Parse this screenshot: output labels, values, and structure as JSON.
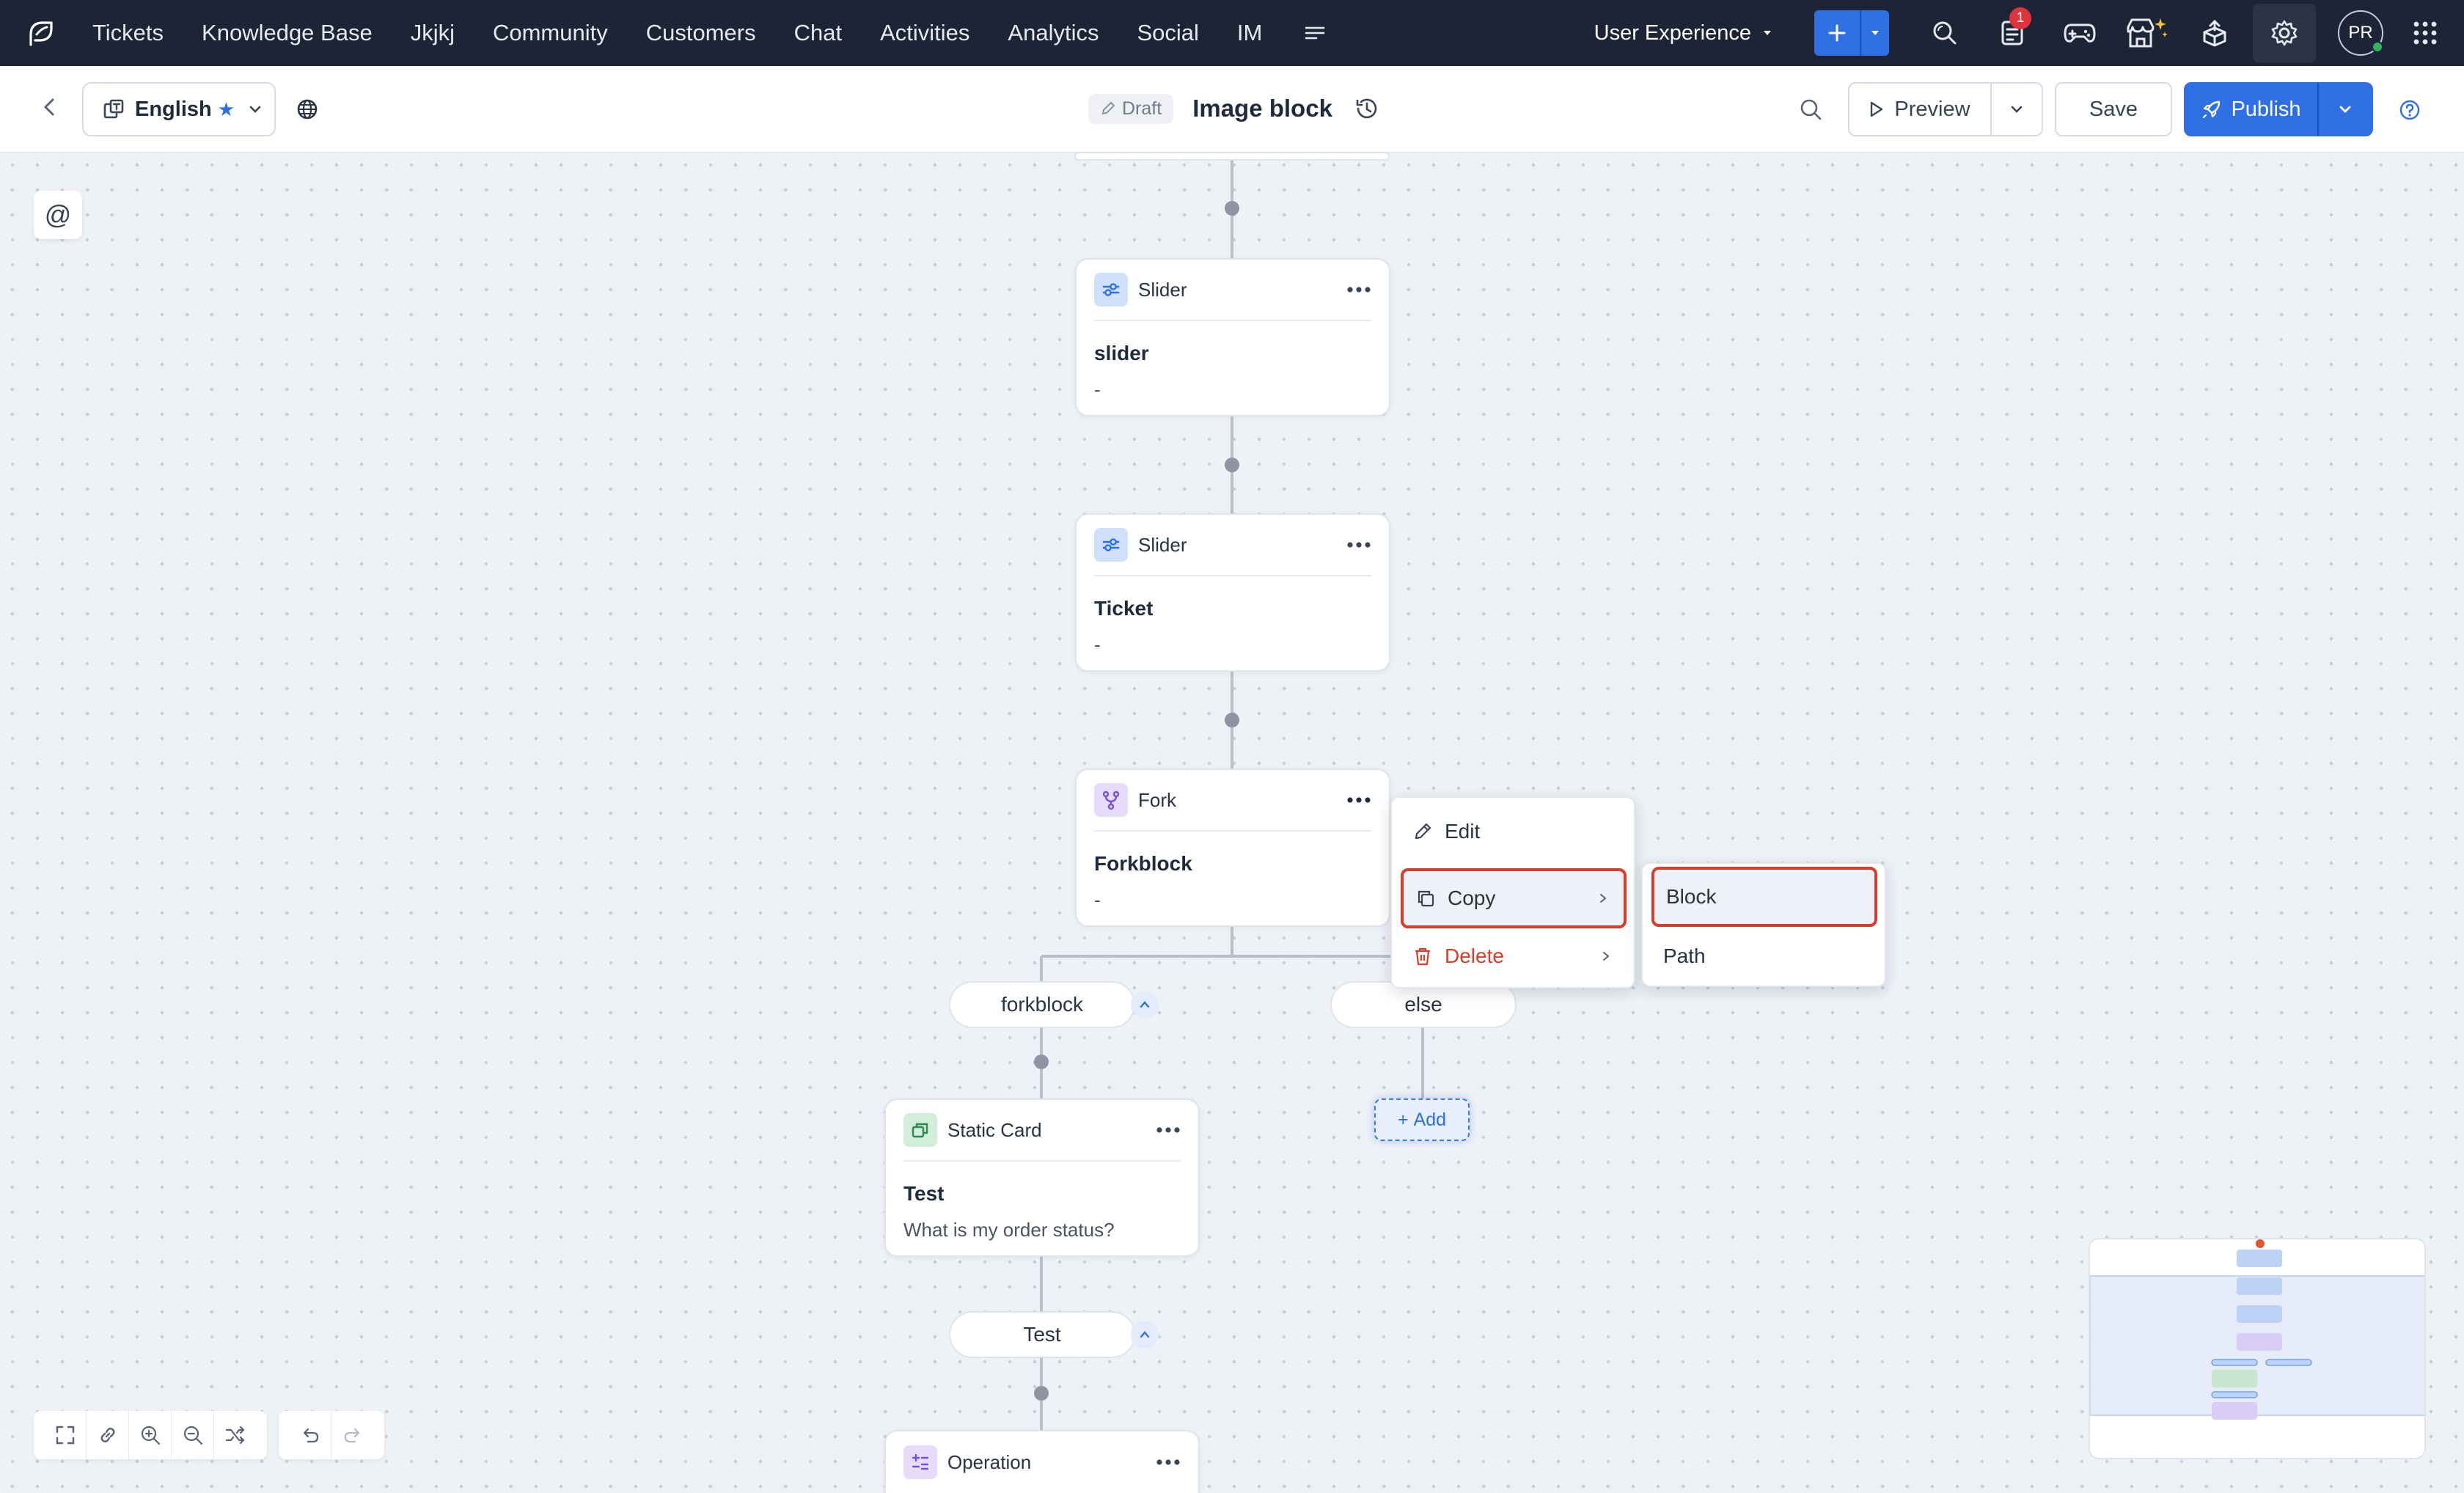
{
  "topnav": {
    "items": [
      "Tickets",
      "Knowledge Base",
      "Jkjkj",
      "Community",
      "Customers",
      "Chat",
      "Activities",
      "Analytics",
      "Social",
      "IM"
    ],
    "department": "User Experience",
    "notification_count": "1",
    "avatar_initials": "PR"
  },
  "toolbar": {
    "language": "English",
    "status": "Draft",
    "title": "Image block",
    "preview_label": "Preview",
    "save_label": "Save",
    "publish_label": "Publish"
  },
  "canvas": {
    "mention_symbol": "@",
    "cards": [
      {
        "type": "Slider",
        "name": "slider",
        "sub": "-"
      },
      {
        "type": "Slider",
        "name": "Ticket",
        "sub": "-"
      },
      {
        "type": "Fork",
        "name": "Forkblock",
        "sub": "-"
      },
      {
        "type": "Static Card",
        "name": "Test",
        "sub": "What is my order status?"
      },
      {
        "type": "Operation"
      }
    ],
    "paths": [
      "forkblock",
      "else",
      "Test"
    ],
    "add_label": "Add"
  },
  "context_menu": {
    "items": [
      "Edit",
      "Copy",
      "Delete"
    ],
    "copy_submenu": [
      "Block",
      "Path"
    ]
  },
  "colors": {
    "nav_bg": "#1c2436",
    "accent": "#2f6fe4",
    "danger": "#d63d2a",
    "canvas_bg": "#eef1f6"
  }
}
